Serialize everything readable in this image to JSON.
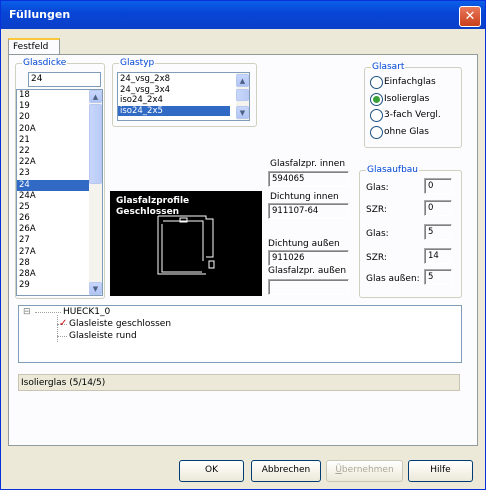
{
  "window": {
    "title": "Füllungen",
    "close_symbol": "✕"
  },
  "tabs": [
    {
      "label": "Festfeld"
    }
  ],
  "glasdicke": {
    "label": "Glasdicke",
    "input_value": "24",
    "items": [
      "18",
      "19",
      "20",
      "20A",
      "21",
      "22",
      "22A",
      "23",
      "24",
      "24A",
      "25",
      "26",
      "26A",
      "27",
      "27A",
      "28",
      "28A",
      "29"
    ],
    "selected": "24"
  },
  "glastyp": {
    "label": "Glastyp",
    "items": [
      "24_vsg_2x8",
      "24_vsg_3x4",
      "iso24_2x4",
      "iso24_2x5"
    ],
    "selected": "iso24_2x5"
  },
  "glasart": {
    "label": "Glasart",
    "options": [
      "Einfachglas",
      "Isolierglas",
      "3-fach Vergl.",
      "ohne Glas"
    ],
    "selected": "Isolierglas"
  },
  "preview": {
    "line1": "Glasfalzprofile",
    "line2": "Geschlossen"
  },
  "details": {
    "glasfalzpr_innen_label": "Glasfalzpr. innen",
    "glasfalzpr_innen_value": "594065",
    "dichtung_innen_label": "Dichtung innen",
    "dichtung_innen_value": "911107-64",
    "dichtung_aussen_label": "Dichtung außen",
    "dichtung_aussen_value": "911026",
    "glasfalzpr_aussen_label": "Glasfalzpr. außen",
    "glasfalzpr_aussen_value": ""
  },
  "glasaufbau": {
    "label": "Glasaufbau",
    "rows": [
      {
        "label": "Glas:",
        "value": "0"
      },
      {
        "label": "SZR:",
        "value": "0"
      },
      {
        "label": "Glas:",
        "value": "5"
      },
      {
        "label": "SZR:",
        "value": "14"
      },
      {
        "label": "Glas außen:",
        "value": "5"
      }
    ]
  },
  "tree": {
    "root": "HUECK1_0",
    "expander": "⊟",
    "children": [
      {
        "label": "Glasleiste geschlossen",
        "checked": true
      },
      {
        "label": "Glasleiste rund",
        "checked": false
      }
    ]
  },
  "status_text": "Isolierglas (5/14/5)",
  "buttons": {
    "ok": "OK",
    "cancel": "Abbrechen",
    "apply_first": "Ü",
    "apply_rest": "bernehmen",
    "help": "Hilfe"
  }
}
